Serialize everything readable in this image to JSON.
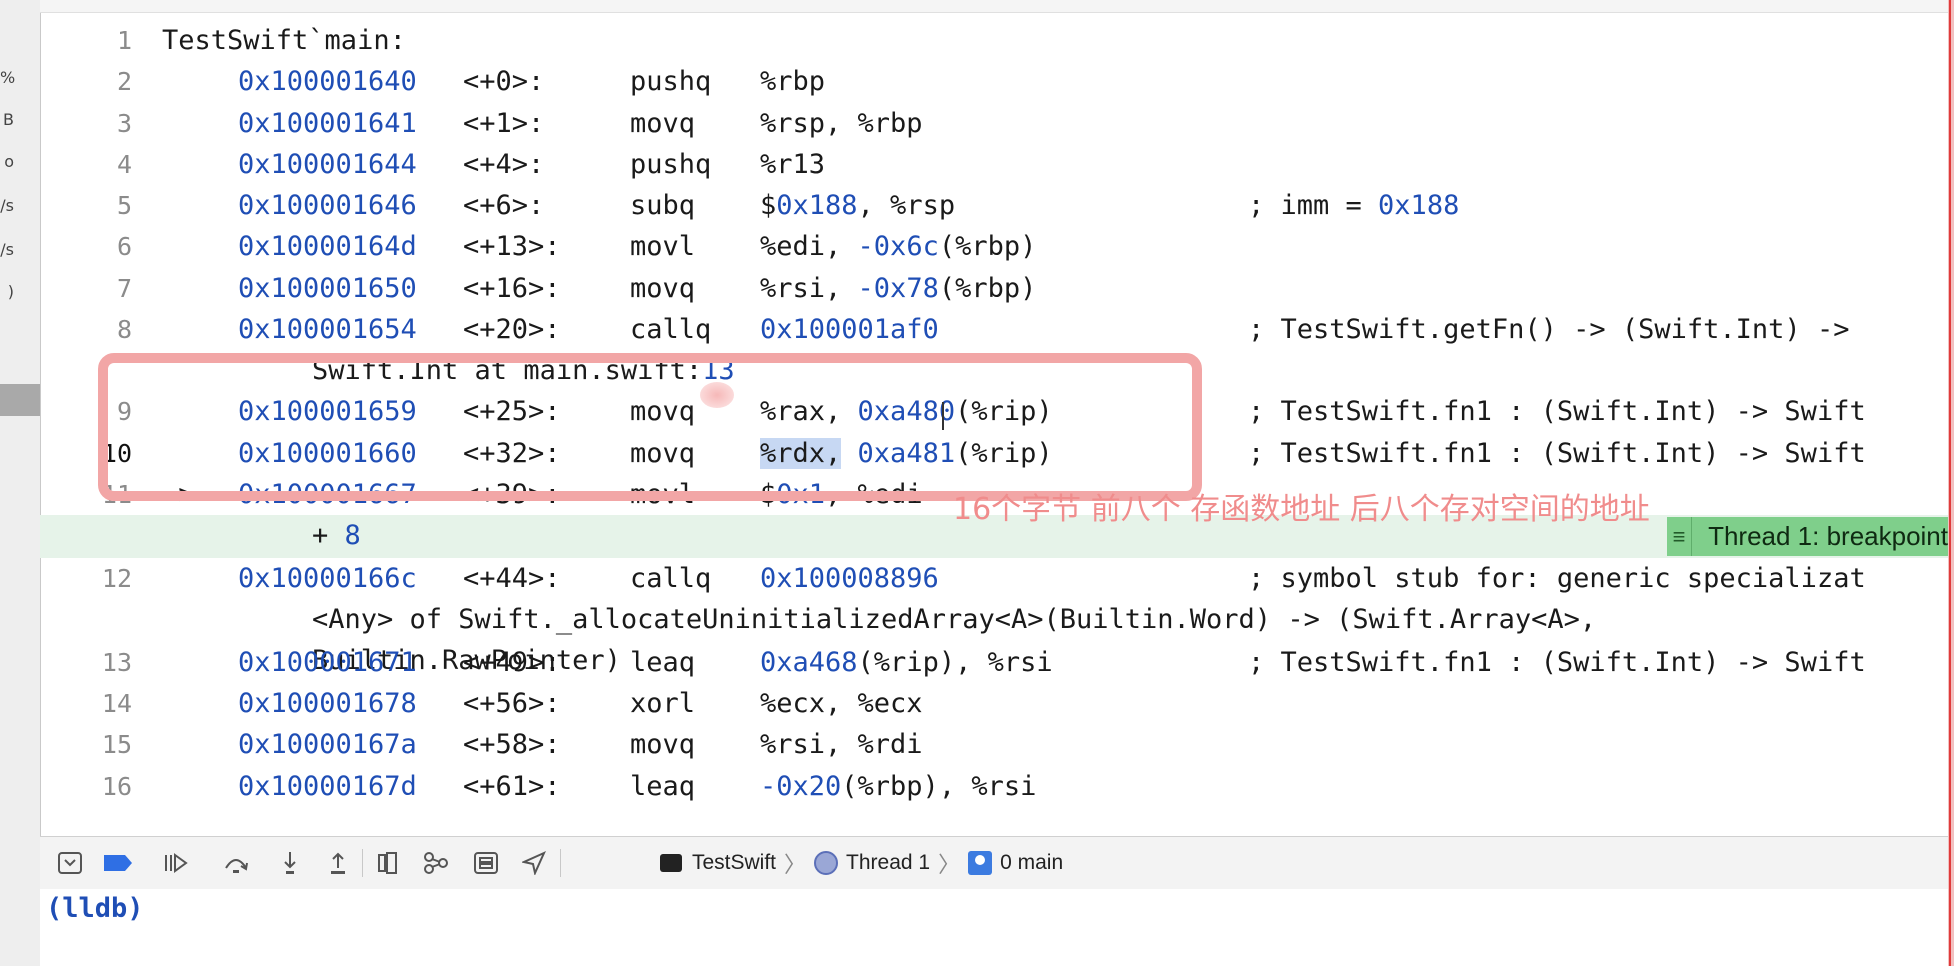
{
  "sidebar": {
    "labels": [
      "%",
      "B",
      "o",
      "/s",
      "/s",
      ")"
    ]
  },
  "code_title": "TestSwift`main:",
  "lines": [
    {
      "num": "2",
      "addr": "0x100001640",
      "off": "<+0>:",
      "mn": "pushq",
      "ops": "%rbp"
    },
    {
      "num": "3",
      "addr": "0x100001641",
      "off": "<+1>:",
      "mn": "movq",
      "ops": "%rsp, %rbp"
    },
    {
      "num": "4",
      "addr": "0x100001644",
      "off": "<+4>:",
      "mn": "pushq",
      "ops": "%r13"
    },
    {
      "num": "5",
      "addr": "0x100001646",
      "off": "<+6>:",
      "mn": "subq",
      "ops_a": "$",
      "ops_num": "0x188",
      "ops_b": ", %rsp",
      "cmt_a": "; imm = ",
      "cmt_num": "0x188"
    },
    {
      "num": "6",
      "addr": "0x10000164d",
      "off": "<+13>:",
      "mn": "movl",
      "ops_a": "%edi, ",
      "ops_num": "-0x6c",
      "ops_b": "(%rbp)"
    },
    {
      "num": "7",
      "addr": "0x100001650",
      "off": "<+16>:",
      "mn": "movq",
      "ops_a": "%rsi, ",
      "ops_num": "-0x78",
      "ops_b": "(%rbp)"
    },
    {
      "num": "8",
      "addr": "0x100001654",
      "off": "<+20>:",
      "mn": "callq",
      "ops_num": "0x100001af0",
      "cmt": "; TestSwift.getFn() -> (Swift.Int) ->",
      "cont_a": "Swift.Int at main.swift:",
      "cont_num": "13"
    },
    {
      "num": "9",
      "addr": "0x100001659",
      "off": "<+25>:",
      "mn": "movq",
      "ops_a": "%rax, ",
      "ops_num": "0xa480",
      "ops_b": "(%rip)",
      "cmt": "; TestSwift.fn1 : (Swift.Int) -> Swift"
    },
    {
      "num": "10",
      "addr": "0x100001660",
      "off": "<+32>:",
      "mn": "movq",
      "ops_hl": "%rdx,",
      "ops_num": "0xa481",
      "ops_b": "(%rip)",
      "cmt": "; TestSwift.fn1 : (Swift.Int) -> Swift",
      "cont_a": "+ ",
      "cont_num": "8"
    },
    {
      "num": "11",
      "arrow": "->",
      "addr": "0x100001667",
      "off": "<+39>:",
      "mn": "movl",
      "ops_a": "$",
      "ops_num": "0x1",
      "ops_b": ", %edi"
    },
    {
      "num": "12",
      "addr": "0x10000166c",
      "off": "<+44>:",
      "mn": "callq",
      "ops_num": "0x100008896",
      "cmt": "; symbol stub for: generic specializat",
      "cont1": "<Any> of Swift._allocateUninitializedArray<A>(Builtin.Word) -> (Swift.Array<A>,",
      "cont2": "Builtin.RawPointer)"
    },
    {
      "num": "13",
      "addr": "0x100001671",
      "off": "<+49>:",
      "mn": "leaq",
      "ops_num": "0xa468",
      "ops_b": "(%rip), %rsi",
      "cmt": "; TestSwift.fn1 : (Swift.Int) -> Swift"
    },
    {
      "num": "14",
      "addr": "0x100001678",
      "off": "<+56>:",
      "mn": "xorl",
      "ops": "%ecx, %ecx"
    },
    {
      "num": "15",
      "addr": "0x10000167a",
      "off": "<+58>:",
      "mn": "movq",
      "ops": "%rsi, %rdi"
    },
    {
      "num": "16",
      "addr": "0x10000167d",
      "off": "<+61>:",
      "mn": "leaq",
      "ops_num": "-0x20",
      "ops_b": "(%rbp), %rsi"
    }
  ],
  "annotation": "16个字节 前八个 存函数地址 后八个存对空间的地址",
  "thread_badge": "Thread 1: breakpoint",
  "debug_bar": {
    "breadcrumb": [
      "TestSwift",
      "Thread 1",
      "0 main"
    ]
  },
  "console": {
    "prompt": "(lldb)"
  },
  "colors": {
    "address": "#1f4eb5",
    "current_line": "#e6f3e9",
    "badge": "#7fcf8b",
    "annotation": "#f2a6a6"
  }
}
